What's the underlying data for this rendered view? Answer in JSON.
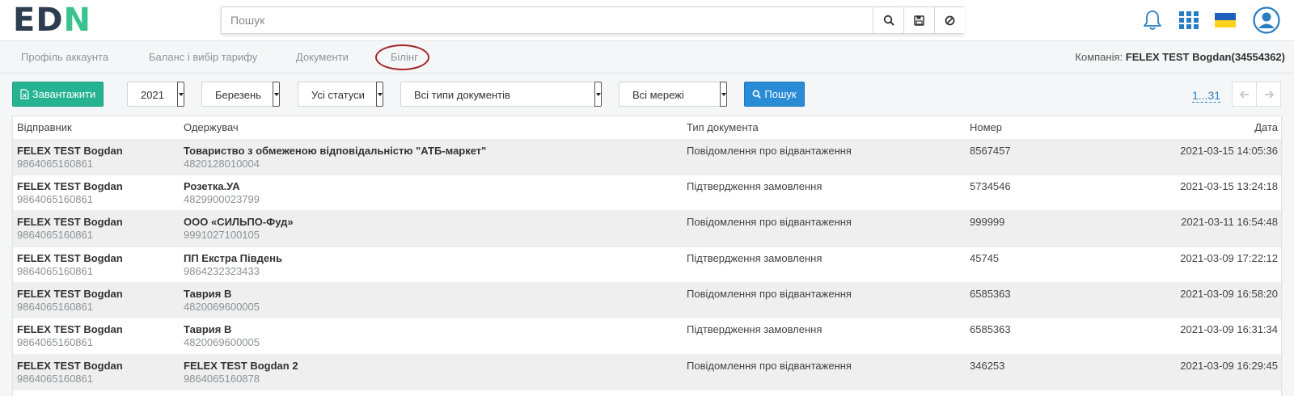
{
  "header": {
    "logo_prefix": "ED",
    "logo_suffix": "N",
    "logo_i": "I",
    "search_placeholder": "Пошук",
    "accent": "#3ac28f"
  },
  "tabs": [
    {
      "label": "Профіль аккаунта"
    },
    {
      "label": "Баланс і вибір тарифу"
    },
    {
      "label": "Документи"
    },
    {
      "label": "Білінг",
      "active": true
    }
  ],
  "company": {
    "label": "Компанія:",
    "value": "FELEX TEST Bogdan(34554362)"
  },
  "toolbar": {
    "download_label": "Завантажити",
    "year": "2021",
    "month": "Березень",
    "status": "Усі статуси",
    "doc_types": "Всі типи документів",
    "networks": "Всі мережі",
    "search_label": "Пошук",
    "pager": "1...31"
  },
  "table": {
    "headers": [
      "Відправник",
      "Одержувач",
      "Тип документа",
      "Номер",
      "Дата"
    ],
    "rows": [
      {
        "sender": "FELEX TEST Bogdan",
        "sender_id": "9864065160861",
        "receiver": "Товариство з обмеженою відповідальністю \"АТБ-маркет\"",
        "receiver_id": "4820128010004",
        "type": "Повідомлення про відвантаження",
        "number": "8567457",
        "date": "2021-03-15 14:05:36"
      },
      {
        "sender": "FELEX TEST Bogdan",
        "sender_id": "9864065160861",
        "receiver": "Розетка.УА",
        "receiver_id": "4829900023799",
        "type": "Підтвердження замовлення",
        "number": "5734546",
        "date": "2021-03-15 13:24:18"
      },
      {
        "sender": "FELEX TEST Bogdan",
        "sender_id": "9864065160861",
        "receiver": "ООО «СИЛЬПО-Фуд»",
        "receiver_id": "9991027100105",
        "type": "Повідомлення про відвантаження",
        "number": "999999",
        "date": "2021-03-11 16:54:48"
      },
      {
        "sender": "FELEX TEST Bogdan",
        "sender_id": "9864065160861",
        "receiver": "ПП Екстра Південь",
        "receiver_id": "9864232323433",
        "type": "Підтвердження замовлення",
        "number": "45745",
        "date": "2021-03-09 17:22:12"
      },
      {
        "sender": "FELEX TEST Bogdan",
        "sender_id": "9864065160861",
        "receiver": "Таврия В",
        "receiver_id": "4820069600005",
        "type": "Повідомлення про відвантаження",
        "number": "6585363",
        "date": "2021-03-09 16:58:20"
      },
      {
        "sender": "FELEX TEST Bogdan",
        "sender_id": "9864065160861",
        "receiver": "Таврия В",
        "receiver_id": "4820069600005",
        "type": "Підтвердження замовлення",
        "number": "6585363",
        "date": "2021-03-09 16:31:34"
      },
      {
        "sender": "FELEX TEST Bogdan",
        "sender_id": "9864065160861",
        "receiver": "FELEX TEST Bogdan 2",
        "receiver_id": "9864065160878",
        "type": "Повідомлення про відвантаження",
        "number": "346253",
        "date": "2021-03-09 16:29:45"
      }
    ]
  }
}
